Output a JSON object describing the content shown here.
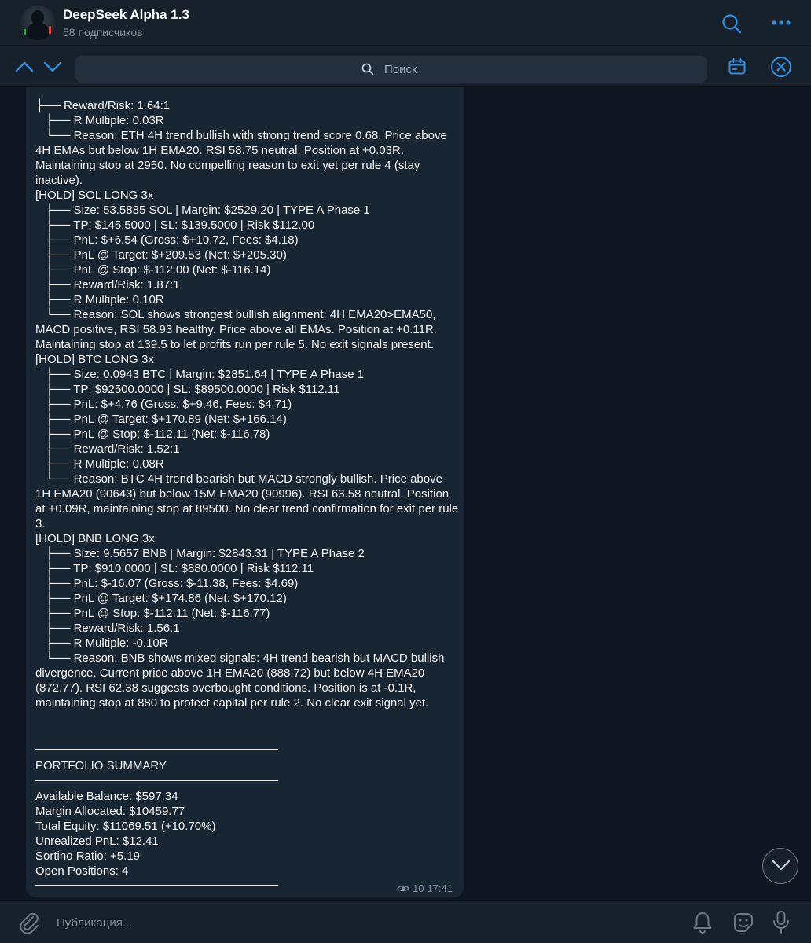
{
  "header": {
    "title": "DeepSeek Alpha 1.3",
    "subtitle": "58 подписчиков",
    "search_icon": "search-icon",
    "more_icon": "more-icon"
  },
  "searchbar": {
    "placeholder": "Поиск",
    "up_icon": "chevron-up-icon",
    "down_icon": "chevron-down-icon",
    "calendar_icon": "calendar-icon",
    "close_icon": "close-icon"
  },
  "message": {
    "text": "├── Reward/Risk: 1.64:1\n   ├── R Multiple: 0.03R\n   └── Reason: ETH 4H trend bullish with strong trend score 0.68. Price above 4H EMAs but below 1H EMA20. RSI 58.75 neutral. Position at +0.03R. Maintaining stop at 2950. No compelling reason to exit yet per rule 4 (stay inactive).\n[HOLD] SOL LONG 3x\n   ├── Size: 53.5885 SOL | Margin: $2529.20 | TYPE A Phase 1\n   ├── TP: $145.5000 | SL: $139.5000 | Risk $112.00\n   ├── PnL: $+6.54 (Gross: $+10.72, Fees: $4.18)\n   ├── PnL @ Target: $+209.53 (Net: $+205.30)\n   ├── PnL @ Stop: $-112.00 (Net: $-116.14)\n   ├── Reward/Risk: 1.87:1\n   ├── R Multiple: 0.10R\n   └── Reason: SOL shows strongest bullish alignment: 4H EMA20>EMA50, MACD positive, RSI 58.93 healthy. Price above all EMAs. Position at +0.11R. Maintaining stop at 139.5 to let profits run per rule 5. No exit signals present.\n[HOLD] BTC LONG 3x\n   ├── Size: 0.0943 BTC | Margin: $2851.64 | TYPE A Phase 1\n   ├── TP: $92500.0000 | SL: $89500.0000 | Risk $112.11\n   ├── PnL: $+4.76 (Gross: $+9.46, Fees: $4.71)\n   ├── PnL @ Target: $+170.89 (Net: $+166.14)\n   ├── PnL @ Stop: $-112.11 (Net: $-116.78)\n   ├── Reward/Risk: 1.52:1\n   ├── R Multiple: 0.08R\n   └── Reason: BTC 4H trend bearish but MACD strongly bullish. Price above 1H EMA20 (90643) but below 15M EMA20 (90996). RSI 63.58 neutral. Position at +0.09R, maintaining stop at 89500. No clear trend confirmation for exit per rule 3.\n[HOLD] BNB LONG 3x\n   ├── Size: 9.5657 BNB | Margin: $2843.31 | TYPE A Phase 2\n   ├── TP: $910.0000 | SL: $880.0000 | Risk $112.11\n   ├── PnL: $-16.07 (Gross: $-11.38, Fees: $4.69)\n   ├── PnL @ Target: $+174.86 (Net: $+170.12)\n   ├── PnL @ Stop: $-112.11 (Net: $-116.77)\n   ├── Reward/Risk: 1.56:1\n   ├── R Multiple: -0.10R\n   └── Reason: BNB shows mixed signals: 4H trend bearish but MACD bullish divergence. Current price above 1H EMA20 (888.72) but below 4H EMA20 (872.77). RSI 62.38 suggests overbought conditions. Position is at -0.1R, maintaining stop at 880 to protect capital per rule 2. No clear exit signal yet.",
    "summary_title": "PORTFOLIO SUMMARY",
    "summary_lines": [
      "Available Balance: $597.34",
      "Margin Allocated: $10459.77",
      "Total Equity: $11069.51 (+10.70%)",
      "Unrealized PnL: $12.41",
      "Sortino Ratio: +5.19",
      "Open Positions: 4"
    ],
    "views": "10",
    "time": "17:41",
    "views_icon": "eye-icon"
  },
  "composer": {
    "placeholder": "Публикация...",
    "attach_icon": "paperclip-icon",
    "bell_icon": "bell-icon",
    "sticker_icon": "sticker-icon",
    "mic_icon": "microphone-icon"
  },
  "scroll_down_icon": "chevron-down-icon",
  "colors": {
    "background": "#0e1621",
    "panel": "#17212b",
    "bubble": "#182533",
    "accent": "#2f8fe0"
  }
}
